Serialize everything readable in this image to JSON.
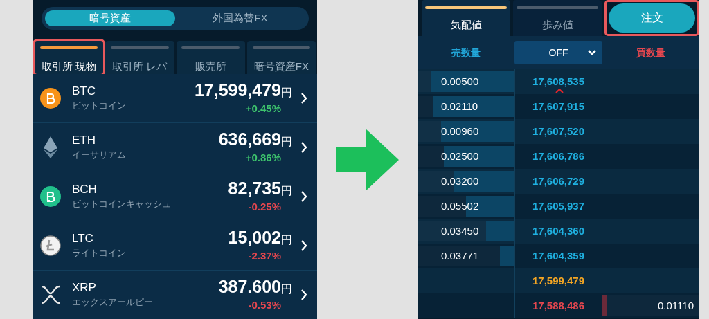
{
  "left_panel": {
    "segments": [
      {
        "label": "暗号資産",
        "selected": true
      },
      {
        "label": "外国為替FX",
        "selected": false
      }
    ],
    "tabs": [
      {
        "label": "取引所 現物",
        "selected": true,
        "highlighted": true
      },
      {
        "label": "取引所 レバ",
        "selected": false,
        "highlighted": false
      },
      {
        "label": "販売所",
        "selected": false,
        "highlighted": false
      },
      {
        "label": "暗号資産FX",
        "selected": false,
        "highlighted": false
      }
    ],
    "coins": [
      {
        "kind": "btc",
        "symbol": "BTC",
        "name": "ビットコイン",
        "price": "17,599,479",
        "unit": "円",
        "change": "+0.45%",
        "color": "#3ec46d"
      },
      {
        "kind": "eth",
        "symbol": "ETH",
        "name": "イーサリアム",
        "price": "636,669",
        "unit": "円",
        "change": "+0.86%",
        "color": "#3ec46d"
      },
      {
        "kind": "bch",
        "symbol": "BCH",
        "name": "ビットコインキャッシュ",
        "price": "82,735",
        "unit": "円",
        "change": "-0.25%",
        "color": "#e5474f"
      },
      {
        "kind": "ltc",
        "symbol": "LTC",
        "name": "ライトコイン",
        "price": "15,002",
        "unit": "円",
        "change": "-2.37%",
        "color": "#e5474f"
      },
      {
        "kind": "xrp",
        "symbol": "XRP",
        "name": "エックスアールピー",
        "price": "387.600",
        "unit": "円",
        "change": "-0.53%",
        "color": "#e5474f"
      }
    ]
  },
  "right_panel": {
    "tabs": [
      {
        "label": "気配値",
        "selected": true
      },
      {
        "label": "歩み値",
        "selected": false
      }
    ],
    "order_button": {
      "label": "注文",
      "highlighted": true
    },
    "header": {
      "sell_label": "売数量",
      "filter": "OFF",
      "buy_label": "買数量"
    },
    "rows": [
      {
        "kind": "ask",
        "quantity": "0.00500",
        "price": "17,608,535",
        "level": 0.86,
        "caret": true
      },
      {
        "kind": "ask",
        "quantity": "0.02110",
        "price": "17,607,915",
        "level": 0.84,
        "caret": false
      },
      {
        "kind": "ask",
        "quantity": "0.00960",
        "price": "17,607,520",
        "level": 0.76,
        "caret": false
      },
      {
        "kind": "ask",
        "quantity": "0.02500",
        "price": "17,606,786",
        "level": 0.73,
        "caret": false
      },
      {
        "kind": "ask",
        "quantity": "0.03200",
        "price": "17,606,729",
        "level": 0.63,
        "caret": false
      },
      {
        "kind": "ask",
        "quantity": "0.05502",
        "price": "17,605,937",
        "level": 0.5,
        "caret": false
      },
      {
        "kind": "ask",
        "quantity": "0.03450",
        "price": "17,604,360",
        "level": 0.29,
        "caret": false
      },
      {
        "kind": "ask",
        "quantity": "0.03771",
        "price": "17,604,359",
        "level": 0.15,
        "caret": false
      },
      {
        "kind": "last",
        "price": "17,599,479"
      },
      {
        "kind": "bid",
        "quantity": "0.01110",
        "price": "17,588,486",
        "level": 0.05,
        "caret": false
      }
    ]
  }
}
